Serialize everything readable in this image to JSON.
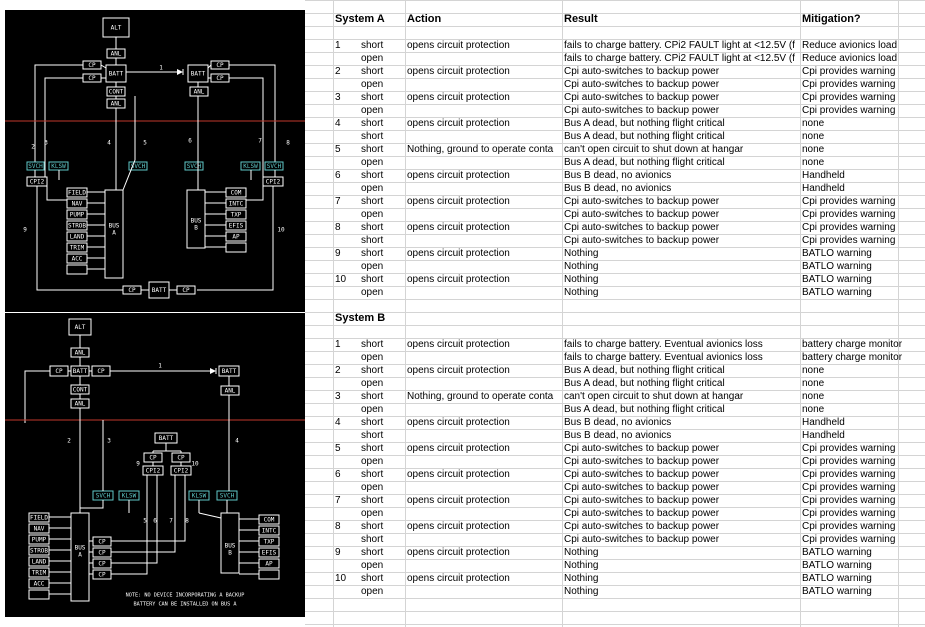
{
  "systemA": {
    "headers": [
      "System A",
      "Action",
      "Result",
      "Mitigation?"
    ],
    "rows": [
      [
        "1",
        "short",
        "opens circuit protection",
        "fails to charge battery.  CPi2 FAULT light at <12.5V (f",
        "Reduce avionics load"
      ],
      [
        "",
        "open",
        "",
        "fails to charge battery.  CPi2 FAULT light at <12.5V (f",
        "Reduce avionics load"
      ],
      [
        "2",
        "short",
        "opens circuit protection",
        "Cpi auto-switches to backup power",
        "Cpi provides warning"
      ],
      [
        "",
        "open",
        "",
        "Cpi auto-switches to backup power",
        "Cpi provides warning"
      ],
      [
        "3",
        "short",
        "opens circuit protection",
        "Cpi auto-switches to backup power",
        "Cpi provides warning"
      ],
      [
        "",
        "open",
        "",
        "Cpi auto-switches to backup power",
        "Cpi provides warning"
      ],
      [
        "4",
        "short",
        "opens circuit protection",
        "Bus A dead, but nothing flight critical",
        "none"
      ],
      [
        "",
        "short",
        "",
        "Bus A dead, but nothing flight critical",
        "none"
      ],
      [
        "5",
        "short",
        "Nothing, ground to operate conta",
        "can't open circuit to shut down at hangar",
        "none"
      ],
      [
        "",
        "open",
        "",
        "Bus A dead, but nothing flight critical",
        "none"
      ],
      [
        "6",
        "short",
        "opens circuit protection",
        "Bus B dead, no avionics",
        "Handheld"
      ],
      [
        "",
        "open",
        "",
        "Bus B dead, no avionics",
        "Handheld"
      ],
      [
        "7",
        "short",
        "opens circuit protection",
        "Cpi auto-switches to backup power",
        "Cpi provides warning"
      ],
      [
        "",
        "open",
        "",
        "Cpi auto-switches to backup power",
        "Cpi provides warning"
      ],
      [
        "8",
        "short",
        "opens circuit protection",
        "Cpi auto-switches to backup power",
        "Cpi provides warning"
      ],
      [
        "",
        "short",
        "",
        "Cpi auto-switches to backup power",
        "Cpi provides warning"
      ],
      [
        "9",
        "short",
        "opens circuit protection",
        "Nothing",
        "BATLO warning"
      ],
      [
        "",
        "open",
        "",
        "Nothing",
        "BATLO warning"
      ],
      [
        "10",
        "short",
        "opens circuit protection",
        "Nothing",
        "BATLO warning"
      ],
      [
        "",
        "open",
        "",
        "Nothing",
        "BATLO warning"
      ]
    ]
  },
  "systemB": {
    "header": "System B",
    "rows": [
      [
        "1",
        "short",
        "opens circuit protection",
        "fails to charge battery.  Eventual avionics loss",
        "battery charge monitor"
      ],
      [
        "",
        "open",
        "",
        "fails to charge battery.  Eventual avionics loss",
        "battery charge monitor"
      ],
      [
        "2",
        "short",
        "opens circuit protection",
        "Bus A dead, but nothing flight critical",
        "none"
      ],
      [
        "",
        "open",
        "",
        "Bus A dead, but nothing flight critical",
        "none"
      ],
      [
        "3",
        "short",
        "Nothing, ground to operate conta",
        "can't open circuit to shut down at hangar",
        "none"
      ],
      [
        "",
        "open",
        "",
        "Bus A dead, but nothing flight critical",
        "none"
      ],
      [
        "4",
        "short",
        "opens circuit protection",
        "Bus B dead, no avionics",
        "Handheld"
      ],
      [
        "",
        "short",
        "",
        "Bus B dead, no avionics",
        "Handheld"
      ],
      [
        "5",
        "short",
        "opens circuit protection",
        "Cpi auto-switches to backup power",
        "Cpi provides warning"
      ],
      [
        "",
        "open",
        "",
        "Cpi auto-switches to backup power",
        "Cpi provides warning"
      ],
      [
        "6",
        "short",
        "opens circuit protection",
        "Cpi auto-switches to backup power",
        "Cpi provides warning"
      ],
      [
        "",
        "open",
        "",
        "Cpi auto-switches to backup power",
        "Cpi provides warning"
      ],
      [
        "7",
        "short",
        "opens circuit protection",
        "Cpi auto-switches to backup power",
        "Cpi provides warning"
      ],
      [
        "",
        "open",
        "",
        "Cpi auto-switches to backup power",
        "Cpi provides warning"
      ],
      [
        "8",
        "short",
        "opens circuit protection",
        "Cpi auto-switches to backup power",
        "Cpi provides warning"
      ],
      [
        "",
        "short",
        "",
        "Cpi auto-switches to backup power",
        "Cpi provides warning"
      ],
      [
        "9",
        "short",
        "opens circuit protection",
        "Nothing",
        "BATLO warning"
      ],
      [
        "",
        "open",
        "",
        "Nothing",
        "BATLO warning"
      ],
      [
        "10",
        "short",
        "opens circuit protection",
        "Nothing",
        "BATLO warning"
      ],
      [
        "",
        "open",
        "",
        "Nothing",
        "BATLO warning"
      ]
    ]
  },
  "diagramA": {
    "labels": {
      "alt": "ALT",
      "anl": "ANL",
      "cp": "CP",
      "batt": "BATT",
      "cont": "CONT",
      "svch": "SVCH",
      "klsw": "KLSW",
      "cpi2": "CPI2",
      "bus": "BUS",
      "busA": "A",
      "busB": "B"
    },
    "busAItems": [
      "FIELD",
      "NAV",
      "PUMP",
      "STROB",
      "LAND",
      "TRIM",
      "ACC"
    ],
    "busBItems": [
      "COM",
      "INTC",
      "TXP",
      "EFIS",
      "AP"
    ],
    "wireNumbers": [
      "1",
      "2",
      "3",
      "4",
      "5",
      "6",
      "7",
      "8",
      "9",
      "10"
    ]
  },
  "diagramB": {
    "labels": {
      "alt": "ALT",
      "anl": "ANL",
      "cp": "CP",
      "batt": "BATT",
      "cont": "CONT",
      "svch": "SVCH",
      "klsw": "KLSW",
      "cpi2": "CPI2",
      "bus": "BUS",
      "busA": "A",
      "busB": "B"
    },
    "busAItems": [
      "FIELD",
      "NAV",
      "PUMP",
      "STROB",
      "LAND",
      "TRIM",
      "ACC"
    ],
    "busBItems": [
      "COM",
      "INTC",
      "TXP",
      "EFIS",
      "AP"
    ],
    "wireNumbers": [
      "1",
      "2",
      "3",
      "4",
      "5",
      "6",
      "7",
      "8",
      "9",
      "10"
    ],
    "note": [
      "NOTE: NO DEVICE INCORPORATING A BACKUP",
      "BATTERY CAN BE INSTALLED ON BUS A"
    ]
  },
  "colors": {
    "background": "#000000",
    "line": "#ffffff",
    "boxText": "#ffffff",
    "switchBox": "#5fc8c8",
    "redLine": "#c0392b",
    "gridline": "#d4d4d4"
  }
}
